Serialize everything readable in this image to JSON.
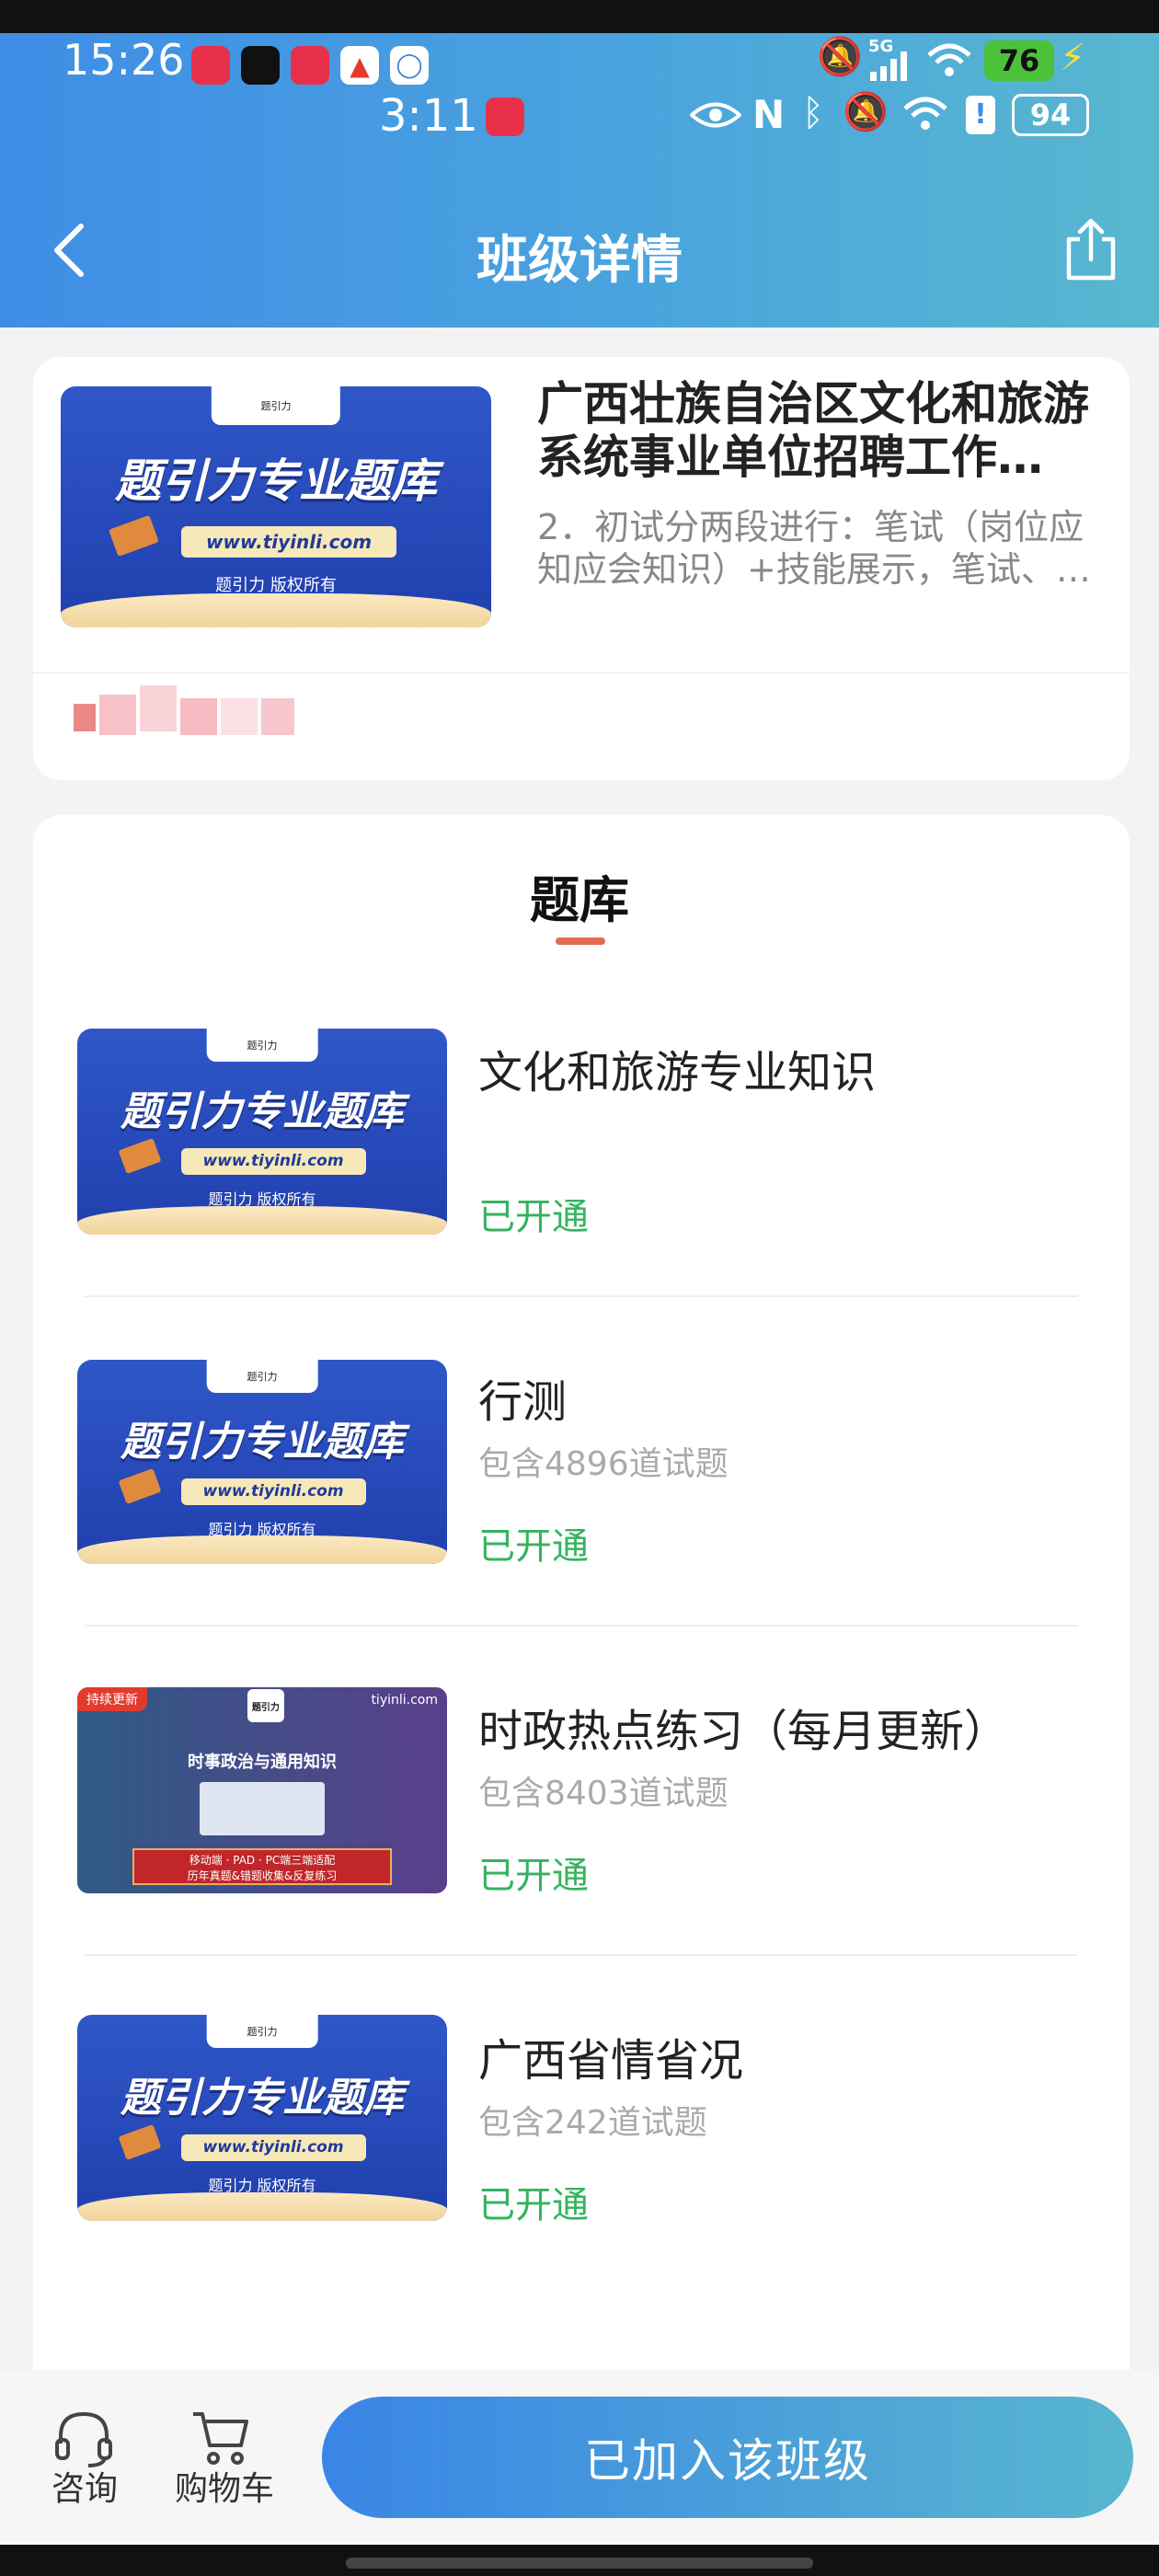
{
  "status_bar": {
    "time_primary": "15:26",
    "time_secondary": "3:11",
    "network": "5G",
    "battery_primary": "76",
    "battery_secondary": "94",
    "app_icons": [
      "小红书",
      "抖音",
      "小红书",
      "app",
      "chat"
    ]
  },
  "nav": {
    "title": "班级详情",
    "back_icon": "chevron-left-icon",
    "share_icon": "share-icon"
  },
  "class_card": {
    "title": "广西壮族自治区文化和旅游系统事业单位招聘工作…",
    "description": "2．初试分两段进行：笔试（岗位应知应会知识）+技能展示，笔试、…",
    "thumb": {
      "tab_label": "题引力",
      "headline": "题引力专业题库",
      "url": "www.tiyinli.com",
      "rights": "题引力 版权所有"
    }
  },
  "bank_section": {
    "title": "题库",
    "items": [
      {
        "title": "文化和旅游专业知识",
        "count": "",
        "status": "已开通",
        "thumb": {
          "tab_label": "题引力",
          "headline": "题引力专业题库",
          "url": "www.tiyinli.com",
          "rights": "题引力 版权所有"
        }
      },
      {
        "title": "行测",
        "count": "包含4896道试题",
        "status": "已开通",
        "thumb": {
          "tab_label": "题引力",
          "headline": "题引力专业题库",
          "url": "www.tiyinli.com",
          "rights": "题引力 版权所有"
        }
      },
      {
        "title": "时政热点练习（每月更新）",
        "count": "包含8403道试题",
        "status": "已开通",
        "thumb": {
          "flag": "持续更新",
          "site": "tiyinli.com",
          "logo": "题引力",
          "headline": "时事政治与通用知识",
          "bar_line1": "移动端 · PAD · PC端三端适配",
          "bar_line2": "历年真题&错题收集&反复练习"
        }
      },
      {
        "title": "广西省情省况",
        "count": "包含242道试题",
        "status": "已开通",
        "thumb": {
          "tab_label": "题引力",
          "headline": "题引力专业题库",
          "url": "www.tiyinli.com",
          "rights": "题引力 版权所有"
        }
      }
    ]
  },
  "bottom_bar": {
    "consult_label": "咨询",
    "cart_label": "购物车",
    "join_label": "已加入该班级"
  },
  "colors": {
    "header_start": "#3f8de6",
    "header_end": "#58b7cf",
    "status_green": "#35b35f",
    "underline_accent": "#e26a4f"
  }
}
